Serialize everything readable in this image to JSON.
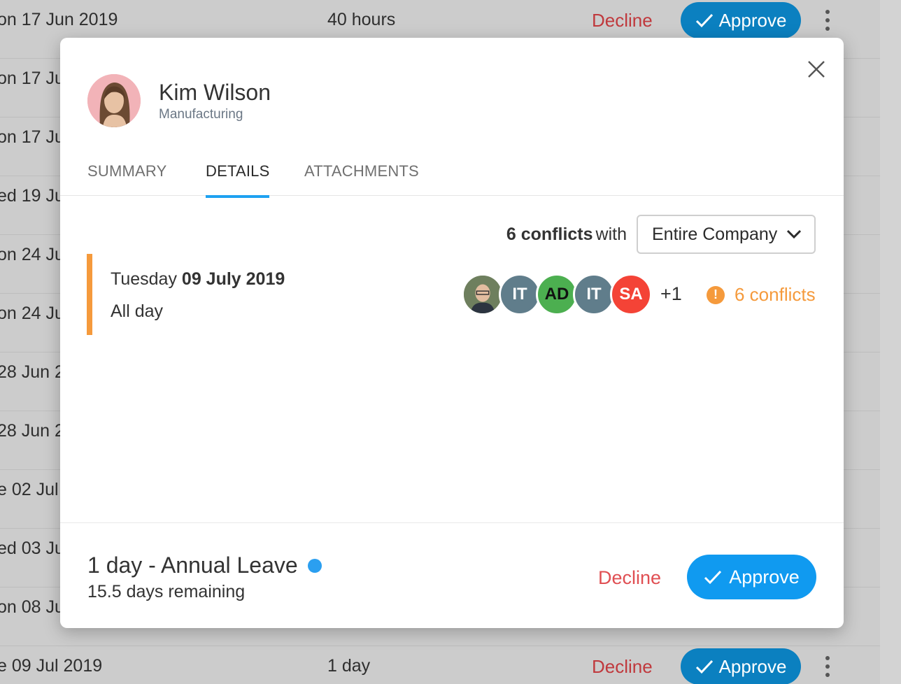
{
  "background": {
    "rows": [
      {
        "date": "on 17 Jun 2019",
        "duration": "40 hours",
        "decline": "Decline",
        "approve": "Approve"
      },
      {
        "date": "on 17 Ju"
      },
      {
        "date": "on 17 Ju"
      },
      {
        "date": "ed 19 Ju"
      },
      {
        "date": "on 24 Ju"
      },
      {
        "date": "on 24 Ju"
      },
      {
        "date": "28 Jun 2"
      },
      {
        "date": "28 Jun 2"
      },
      {
        "date": "e 02 Jul"
      },
      {
        "date": "ed 03 Ju"
      },
      {
        "date": "on 08 Ju"
      },
      {
        "date": "e 09 Jul 2019",
        "duration": "1 day",
        "decline": "Decline",
        "approve": "Approve"
      }
    ]
  },
  "modal": {
    "employee": {
      "name": "Kim Wilson",
      "department": "Manufacturing"
    },
    "tabs": [
      {
        "label": "SUMMARY",
        "active": false
      },
      {
        "label": "DETAILS",
        "active": true
      },
      {
        "label": "ATTACHMENTS",
        "active": false
      }
    ],
    "conflicts": {
      "count_label": "6 conflicts",
      "with_label": "with",
      "scope": "Entire Company",
      "people": [
        {
          "initials": "",
          "color": "#7a8a6a",
          "photo": true
        },
        {
          "initials": "IT",
          "color": "#607d8b"
        },
        {
          "initials": "AD",
          "color": "#4caf50"
        },
        {
          "initials": "IT",
          "color": "#607d8b"
        },
        {
          "initials": "SA",
          "color": "#f44336"
        }
      ],
      "more": "+1",
      "warning_icon": "!",
      "warning_label": "6 conflicts"
    },
    "day": {
      "weekday": "Tuesday",
      "date": "09 July 2019",
      "duration": "All day"
    },
    "footer": {
      "leave_summary": "1 day - Annual Leave",
      "remaining": "15.5 days remaining",
      "decline_label": "Decline",
      "approve_label": "Approve"
    }
  },
  "colors": {
    "accent": "#109af0",
    "warning": "#f59a3c",
    "decline": "#e04f53"
  }
}
